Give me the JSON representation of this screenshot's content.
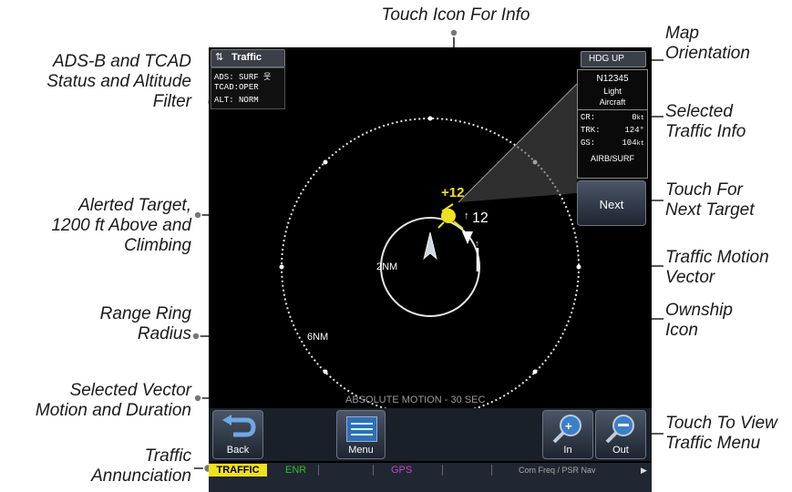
{
  "callouts": {
    "touch_icon_info": "Touch Icon For Info",
    "map_orientation": [
      "Map",
      "Orientation"
    ],
    "adsb_status": [
      "ADS-B and TCAD",
      "Status and Altitude",
      "Filter"
    ],
    "selected_traffic_info": [
      "Selected",
      "Traffic Info"
    ],
    "touch_next": [
      "Touch For",
      "Next Target"
    ],
    "alerted_target": [
      "Alerted Target,",
      "1200 ft Above and",
      "Climbing"
    ],
    "motion_vector": [
      "Traffic Motion",
      "Vector"
    ],
    "range_ring": [
      "Range Ring",
      "Radius"
    ],
    "ownship": [
      "Ownship",
      "Icon"
    ],
    "selected_vector": [
      "Selected Vector",
      "Motion and Duration"
    ],
    "traffic_menu": [
      "Touch To View",
      "Traffic Menu"
    ],
    "traffic_annunciation": [
      "Traffic",
      "Annunciation"
    ]
  },
  "screen": {
    "title": "Traffic",
    "orientation": "HDG UP",
    "status": [
      {
        "key": "ADS:",
        "value": "SURF"
      },
      {
        "key": "TCAD:",
        "value": "OPER"
      },
      {
        "key": "ALT:",
        "value": "NORM"
      }
    ],
    "info": {
      "tail": "N12345",
      "type_line1": "Light",
      "type_line2": "Aircraft",
      "rows": [
        {
          "key": "CR:",
          "value": "0",
          "unit": "kt"
        },
        {
          "key": "TRK:",
          "value": "124°",
          "unit": ""
        },
        {
          "key": "GS:",
          "value": "104",
          "unit": "kt"
        }
      ],
      "mode": "AIRB/SURF"
    },
    "next_label": "Next",
    "alert_target_label": "+12",
    "other_target_label": "12",
    "inner_ring_label": "2NM",
    "outer_ring_label": "6NM",
    "motion_label": "ABSOLUTE MOTION - 30 SEC",
    "buttons": {
      "back": "Back",
      "menu": "Menu",
      "zoom_in": "In",
      "zoom_out": "Out"
    },
    "annunciations": {
      "traffic": "TRAFFIC",
      "enr": "ENR",
      "gps": "GPS",
      "com": "Com Freq / PSR Nav"
    }
  },
  "colors": {
    "alert": "#f0e020",
    "annunciation_bg": "#f0e020",
    "enr": "#2fbf2f",
    "gps": "#c048c8",
    "range_ring": "#e6e6e6"
  }
}
